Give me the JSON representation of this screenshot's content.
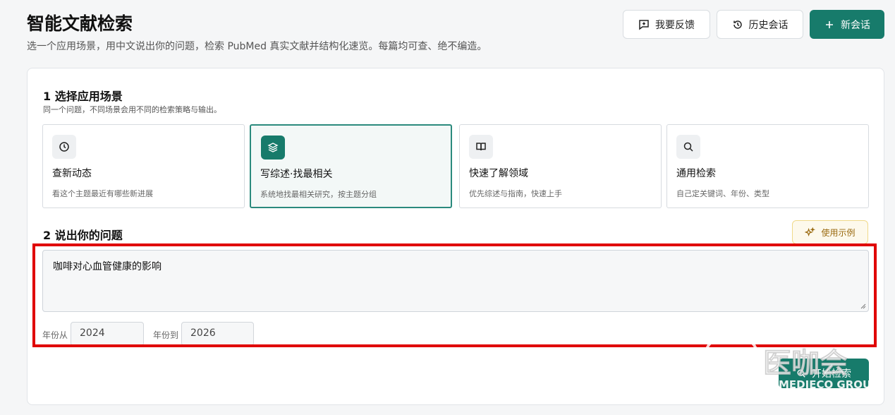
{
  "header": {
    "title": "智能文献检索",
    "subtitle": "选一个应用场景，用中文说出你的问题，检索 PubMed 真实文献并结构化速览。每篇均可查、绝不编造。",
    "feedback_label": "我要反馈",
    "history_label": "历史会话",
    "new_session_label": "新会话"
  },
  "step1": {
    "title": "1 选择应用场景",
    "subtitle": "同一个问题，不同场景会用不同的检索策略与输出。",
    "cards": [
      {
        "title": "查新动态",
        "desc": "看这个主题最近有哪些新进展",
        "icon": "clock-icon",
        "selected": false
      },
      {
        "title": "写综述·找最相关",
        "desc": "系统地找最相关研究，按主题分组",
        "icon": "layers-icon",
        "selected": true
      },
      {
        "title": "快速了解领域",
        "desc": "优先综述与指南，快速上手",
        "icon": "book-icon",
        "selected": false
      },
      {
        "title": "通用检索",
        "desc": "自己定关键词、年份、类型",
        "icon": "search-icon",
        "selected": false
      }
    ]
  },
  "step2": {
    "title": "2 说出你的问题",
    "example_label": "使用示例",
    "question": "咖啡对心血管健康的影响",
    "year_from_label": "年份从",
    "year_from": "2024",
    "year_to_label": "年份到",
    "year_to": "2026"
  },
  "search_label": "开始检索",
  "watermark": {
    "text": "医咖会",
    "sub": "MEDIECO GROUP"
  },
  "colors": {
    "accent": "#177b6b",
    "highlight": "#e00000"
  }
}
